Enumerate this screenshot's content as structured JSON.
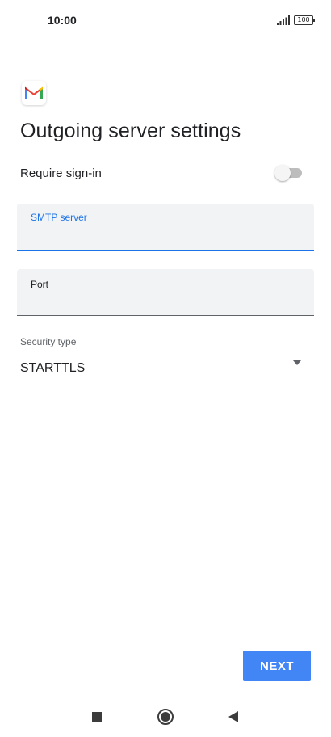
{
  "status_bar": {
    "time": "10:00",
    "battery_level": "100"
  },
  "app": {
    "logo_icon": "gmail-icon",
    "title": "Outgoing server settings"
  },
  "form": {
    "require_signin": {
      "label": "Require sign-in",
      "enabled": false
    },
    "smtp_server": {
      "label": "SMTP server",
      "value": ""
    },
    "port": {
      "label": "Port",
      "value": ""
    },
    "security_type": {
      "label": "Security type",
      "value": "STARTTLS"
    }
  },
  "actions": {
    "next_label": "NEXT"
  },
  "navigation": {
    "icons": [
      "recents-icon",
      "home-icon",
      "back-icon"
    ]
  },
  "colors": {
    "accent": "#1a73e8",
    "button": "#4285f4",
    "field_bg": "#f1f3f4"
  }
}
